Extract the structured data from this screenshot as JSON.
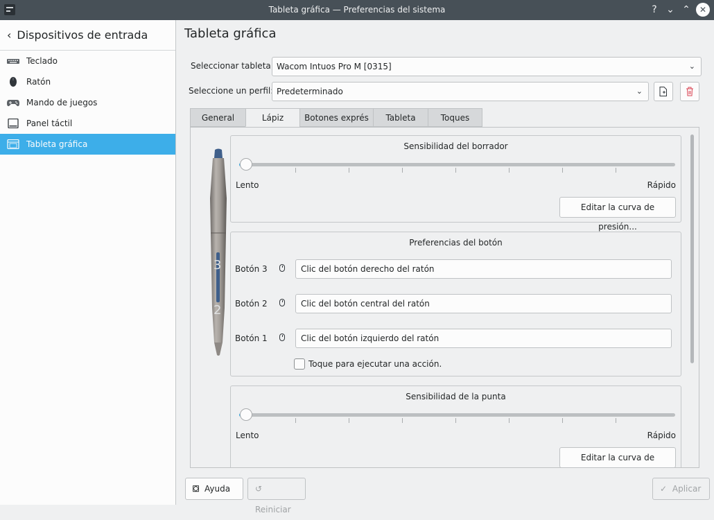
{
  "window": {
    "title": "Tableta gráfica — Preferencias del sistema"
  },
  "titlebar": {
    "help_glyph": "?",
    "minimize_glyph": "⌄",
    "maximize_glyph": "⌃",
    "close_glyph": "✕"
  },
  "sidebar": {
    "back_label": "Dispositivos de entrada",
    "items": [
      {
        "label": "Teclado",
        "icon": "keyboard-icon"
      },
      {
        "label": "Ratón",
        "icon": "mouse-icon"
      },
      {
        "label": "Mando de juegos",
        "icon": "gamepad-icon"
      },
      {
        "label": "Panel táctil",
        "icon": "touchpad-icon"
      },
      {
        "label": "Tableta gráfica",
        "icon": "tablet-icon",
        "active": true
      }
    ]
  },
  "main": {
    "page_title": "Tableta gráfica",
    "select_tablet_label": "Seleccionar tableta:",
    "select_tablet_value": "Wacom Intuos Pro M [0315]",
    "select_profile_label": "Seleccione un perfil:",
    "select_profile_value": "Predeterminado",
    "tabs": [
      {
        "label": "General"
      },
      {
        "label": "Lápiz",
        "active": true
      },
      {
        "label": "Botones exprés"
      },
      {
        "label": "Tableta"
      },
      {
        "label": "Toques"
      }
    ],
    "eraser": {
      "title": "Sensibilidad del borrador",
      "slider_value": 0,
      "min_label": "Lento",
      "max_label": "Rápido",
      "edit_button": "Editar la curva de presión..."
    },
    "buttons": {
      "title": "Preferencias del botón",
      "rows": [
        {
          "label": "Botón 3",
          "value": "Clic del botón derecho del ratón"
        },
        {
          "label": "Botón 2",
          "value": "Clic del botón central del ratón"
        },
        {
          "label": "Botón 1",
          "value": "Clic del botón izquierdo del ratón"
        }
      ],
      "tap_checkbox_label": "Toque para ejecutar una acción.",
      "tap_checked": false
    },
    "tip": {
      "title": "Sensibilidad de la punta",
      "slider_value": 0,
      "min_label": "Lento",
      "max_label": "Rápido",
      "edit_button": "Editar la curva de presión..."
    },
    "pen_labels": {
      "upper": "3",
      "lower": "2"
    }
  },
  "footer": {
    "help_label": "Ayuda",
    "reset_label": "Reiniciar",
    "apply_label": "Aplicar"
  },
  "colors": {
    "accent": "#3daee9",
    "titlebar": "#475057",
    "background": "#eff0f1"
  }
}
